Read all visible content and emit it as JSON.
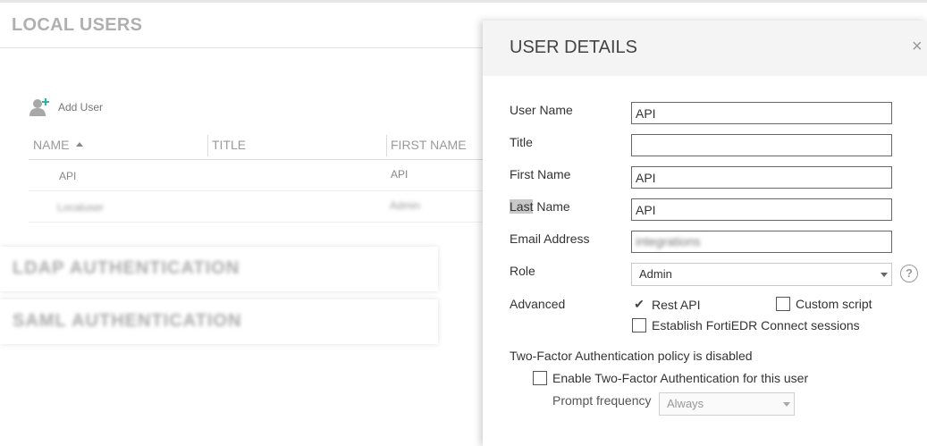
{
  "background": {
    "section_title": "LOCAL USERS",
    "add_user_label": "Add User",
    "table": {
      "headers": [
        "NAME",
        "TITLE",
        "FIRST NAME"
      ],
      "rows": [
        {
          "name": "API",
          "title": "",
          "first_name": "API"
        },
        {
          "name": "Localuser",
          "title": "",
          "first_name": "Admin"
        }
      ]
    },
    "collapsed_sections": [
      "LDAP AUTHENTICATION",
      "SAML AUTHENTICATION"
    ]
  },
  "panel": {
    "title": "USER DETAILS",
    "close_glyph": "×",
    "fields": {
      "user_name": {
        "label": "User Name",
        "value": "API"
      },
      "title": {
        "label": "Title",
        "value": ""
      },
      "first_name": {
        "label": "First Name",
        "value": "API"
      },
      "last_name": {
        "label_highlight": "Last",
        "label_rest": " Name",
        "value": "API"
      },
      "email": {
        "label": "Email Address",
        "value": "integrations"
      },
      "role": {
        "label": "Role",
        "value": "Admin",
        "help_glyph": "?"
      }
    },
    "advanced": {
      "label": "Advanced",
      "rest_api": {
        "label": "Rest API",
        "checked": true,
        "check_glyph": "✔"
      },
      "custom_script": {
        "label": "Custom script",
        "checked": false
      },
      "connect_sessions": {
        "label": "Establish FortiEDR Connect sessions",
        "checked": false
      }
    },
    "two_factor": {
      "policy_text": "Two-Factor Authentication policy is disabled",
      "enable_label": "Enable Two-Factor Authentication for this user",
      "prompt_label": "Prompt frequency",
      "prompt_value": "Always"
    }
  },
  "colors": {
    "panel_header_bg": "#f4f4f4",
    "muted_title": "#b0b0b0",
    "add_user_icon": "#999999",
    "add_user_plus": "#2fb3a0"
  },
  "icons": {
    "add_user": "add-user-icon",
    "sort": "sort-ascending-icon",
    "close": "close-icon",
    "help": "help-icon",
    "checkmark": "checkmark-icon",
    "dropdown": "chevron-down-icon"
  }
}
